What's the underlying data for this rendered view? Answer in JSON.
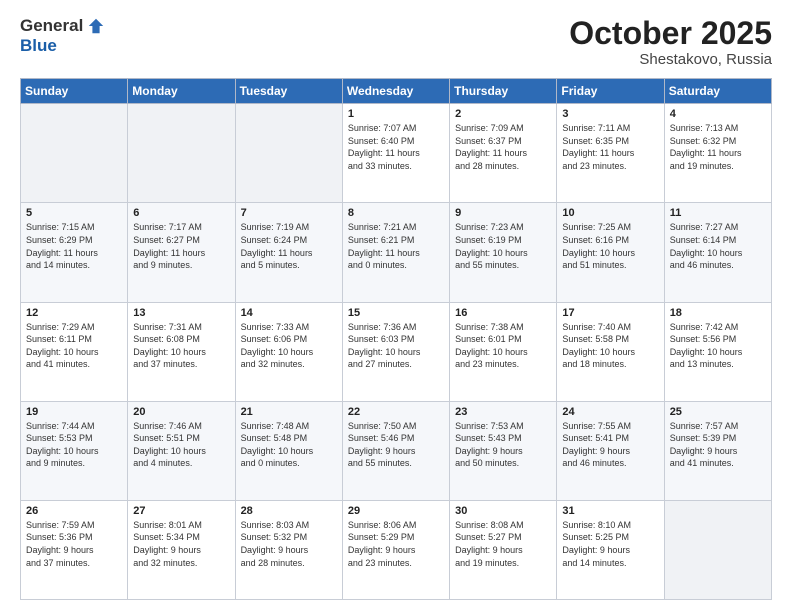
{
  "logo": {
    "general": "General",
    "blue": "Blue"
  },
  "title": {
    "month": "October 2025",
    "location": "Shestakovo, Russia"
  },
  "header": {
    "days": [
      "Sunday",
      "Monday",
      "Tuesday",
      "Wednesday",
      "Thursday",
      "Friday",
      "Saturday"
    ]
  },
  "weeks": [
    [
      {
        "day": "",
        "info": ""
      },
      {
        "day": "",
        "info": ""
      },
      {
        "day": "",
        "info": ""
      },
      {
        "day": "1",
        "info": "Sunrise: 7:07 AM\nSunset: 6:40 PM\nDaylight: 11 hours\nand 33 minutes."
      },
      {
        "day": "2",
        "info": "Sunrise: 7:09 AM\nSunset: 6:37 PM\nDaylight: 11 hours\nand 28 minutes."
      },
      {
        "day": "3",
        "info": "Sunrise: 7:11 AM\nSunset: 6:35 PM\nDaylight: 11 hours\nand 23 minutes."
      },
      {
        "day": "4",
        "info": "Sunrise: 7:13 AM\nSunset: 6:32 PM\nDaylight: 11 hours\nand 19 minutes."
      }
    ],
    [
      {
        "day": "5",
        "info": "Sunrise: 7:15 AM\nSunset: 6:29 PM\nDaylight: 11 hours\nand 14 minutes."
      },
      {
        "day": "6",
        "info": "Sunrise: 7:17 AM\nSunset: 6:27 PM\nDaylight: 11 hours\nand 9 minutes."
      },
      {
        "day": "7",
        "info": "Sunrise: 7:19 AM\nSunset: 6:24 PM\nDaylight: 11 hours\nand 5 minutes."
      },
      {
        "day": "8",
        "info": "Sunrise: 7:21 AM\nSunset: 6:21 PM\nDaylight: 11 hours\nand 0 minutes."
      },
      {
        "day": "9",
        "info": "Sunrise: 7:23 AM\nSunset: 6:19 PM\nDaylight: 10 hours\nand 55 minutes."
      },
      {
        "day": "10",
        "info": "Sunrise: 7:25 AM\nSunset: 6:16 PM\nDaylight: 10 hours\nand 51 minutes."
      },
      {
        "day": "11",
        "info": "Sunrise: 7:27 AM\nSunset: 6:14 PM\nDaylight: 10 hours\nand 46 minutes."
      }
    ],
    [
      {
        "day": "12",
        "info": "Sunrise: 7:29 AM\nSunset: 6:11 PM\nDaylight: 10 hours\nand 41 minutes."
      },
      {
        "day": "13",
        "info": "Sunrise: 7:31 AM\nSunset: 6:08 PM\nDaylight: 10 hours\nand 37 minutes."
      },
      {
        "day": "14",
        "info": "Sunrise: 7:33 AM\nSunset: 6:06 PM\nDaylight: 10 hours\nand 32 minutes."
      },
      {
        "day": "15",
        "info": "Sunrise: 7:36 AM\nSunset: 6:03 PM\nDaylight: 10 hours\nand 27 minutes."
      },
      {
        "day": "16",
        "info": "Sunrise: 7:38 AM\nSunset: 6:01 PM\nDaylight: 10 hours\nand 23 minutes."
      },
      {
        "day": "17",
        "info": "Sunrise: 7:40 AM\nSunset: 5:58 PM\nDaylight: 10 hours\nand 18 minutes."
      },
      {
        "day": "18",
        "info": "Sunrise: 7:42 AM\nSunset: 5:56 PM\nDaylight: 10 hours\nand 13 minutes."
      }
    ],
    [
      {
        "day": "19",
        "info": "Sunrise: 7:44 AM\nSunset: 5:53 PM\nDaylight: 10 hours\nand 9 minutes."
      },
      {
        "day": "20",
        "info": "Sunrise: 7:46 AM\nSunset: 5:51 PM\nDaylight: 10 hours\nand 4 minutes."
      },
      {
        "day": "21",
        "info": "Sunrise: 7:48 AM\nSunset: 5:48 PM\nDaylight: 10 hours\nand 0 minutes."
      },
      {
        "day": "22",
        "info": "Sunrise: 7:50 AM\nSunset: 5:46 PM\nDaylight: 9 hours\nand 55 minutes."
      },
      {
        "day": "23",
        "info": "Sunrise: 7:53 AM\nSunset: 5:43 PM\nDaylight: 9 hours\nand 50 minutes."
      },
      {
        "day": "24",
        "info": "Sunrise: 7:55 AM\nSunset: 5:41 PM\nDaylight: 9 hours\nand 46 minutes."
      },
      {
        "day": "25",
        "info": "Sunrise: 7:57 AM\nSunset: 5:39 PM\nDaylight: 9 hours\nand 41 minutes."
      }
    ],
    [
      {
        "day": "26",
        "info": "Sunrise: 7:59 AM\nSunset: 5:36 PM\nDaylight: 9 hours\nand 37 minutes."
      },
      {
        "day": "27",
        "info": "Sunrise: 8:01 AM\nSunset: 5:34 PM\nDaylight: 9 hours\nand 32 minutes."
      },
      {
        "day": "28",
        "info": "Sunrise: 8:03 AM\nSunset: 5:32 PM\nDaylight: 9 hours\nand 28 minutes."
      },
      {
        "day": "29",
        "info": "Sunrise: 8:06 AM\nSunset: 5:29 PM\nDaylight: 9 hours\nand 23 minutes."
      },
      {
        "day": "30",
        "info": "Sunrise: 8:08 AM\nSunset: 5:27 PM\nDaylight: 9 hours\nand 19 minutes."
      },
      {
        "day": "31",
        "info": "Sunrise: 8:10 AM\nSunset: 5:25 PM\nDaylight: 9 hours\nand 14 minutes."
      },
      {
        "day": "",
        "info": ""
      }
    ]
  ]
}
